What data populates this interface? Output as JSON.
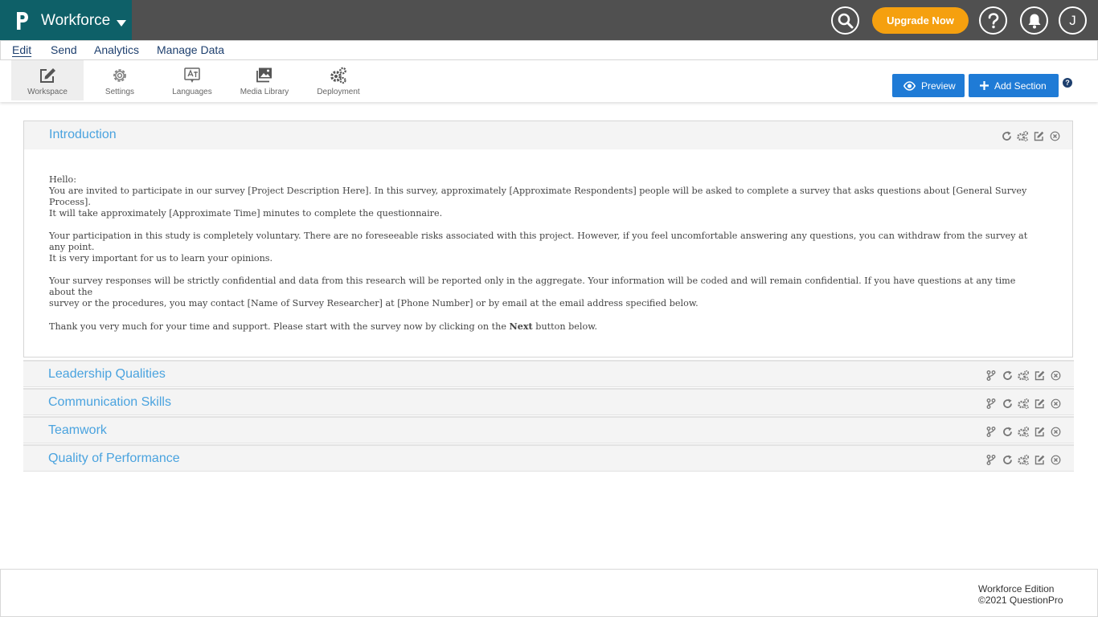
{
  "app": {
    "name": "Workforce",
    "upgrade_label": "Upgrade Now",
    "user_initial": "J"
  },
  "menu": {
    "items": [
      {
        "label": "Edit"
      },
      {
        "label": "Send"
      },
      {
        "label": "Analytics"
      },
      {
        "label": "Manage Data"
      }
    ]
  },
  "toolbar": {
    "tools": [
      {
        "label": "Workspace",
        "icon": "edit-icon"
      },
      {
        "label": "Settings",
        "icon": "gear-icon"
      },
      {
        "label": "Languages",
        "icon": "translate-icon"
      },
      {
        "label": "Media Library",
        "icon": "images-icon"
      },
      {
        "label": "Deployment",
        "icon": "gears-icon"
      }
    ],
    "preview_label": "Preview",
    "add_section_label": "Add Section",
    "help_glyph": "?"
  },
  "sections": {
    "intro": {
      "title": "Introduction",
      "greeting": "Hello:",
      "p1_line1": "You are invited to participate in our survey [Project Description Here]. In this survey, approximately [Approximate Respondents] people will be asked to complete a survey that asks questions about [General Survey Process].",
      "p1_line2": "It will take approximately [Approximate Time] minutes to complete the questionnaire.",
      "p2_line1": "Your participation in this study is completely voluntary. There are no foreseeable risks associated with this project. However, if you feel uncomfortable answering any questions, you can withdraw from the survey at any point.",
      "p2_line2": "It is very important for us to learn your opinions.",
      "p3_line1": "Your survey responses will be strictly confidential and data from this research will be reported only in the aggregate. Your information will be coded and will remain confidential. If you have questions at any time about the",
      "p3_line2": "survey or the procedures, you may contact [Name of Survey Researcher] at [Phone Number] or by email at the email address specified below.",
      "p4_before": "Thank you very much for your time and support. Please start with the survey now by clicking on the ",
      "p4_bold": "Next",
      "p4_after": " button below."
    },
    "list": [
      {
        "title": "Leadership Qualities"
      },
      {
        "title": "Communication Skills"
      },
      {
        "title": "Teamwork"
      },
      {
        "title": "Quality of Performance"
      }
    ]
  },
  "footer": {
    "edition": "Workforce Edition",
    "copyright": "©2021 QuestionPro"
  },
  "colors": {
    "topbar": "#505050",
    "brand": "#0e6068",
    "upgrade": "#f5a00f",
    "primary_button": "#1f7bd6",
    "section_title": "#4aa3df",
    "menu_text": "#1d3f6e"
  }
}
